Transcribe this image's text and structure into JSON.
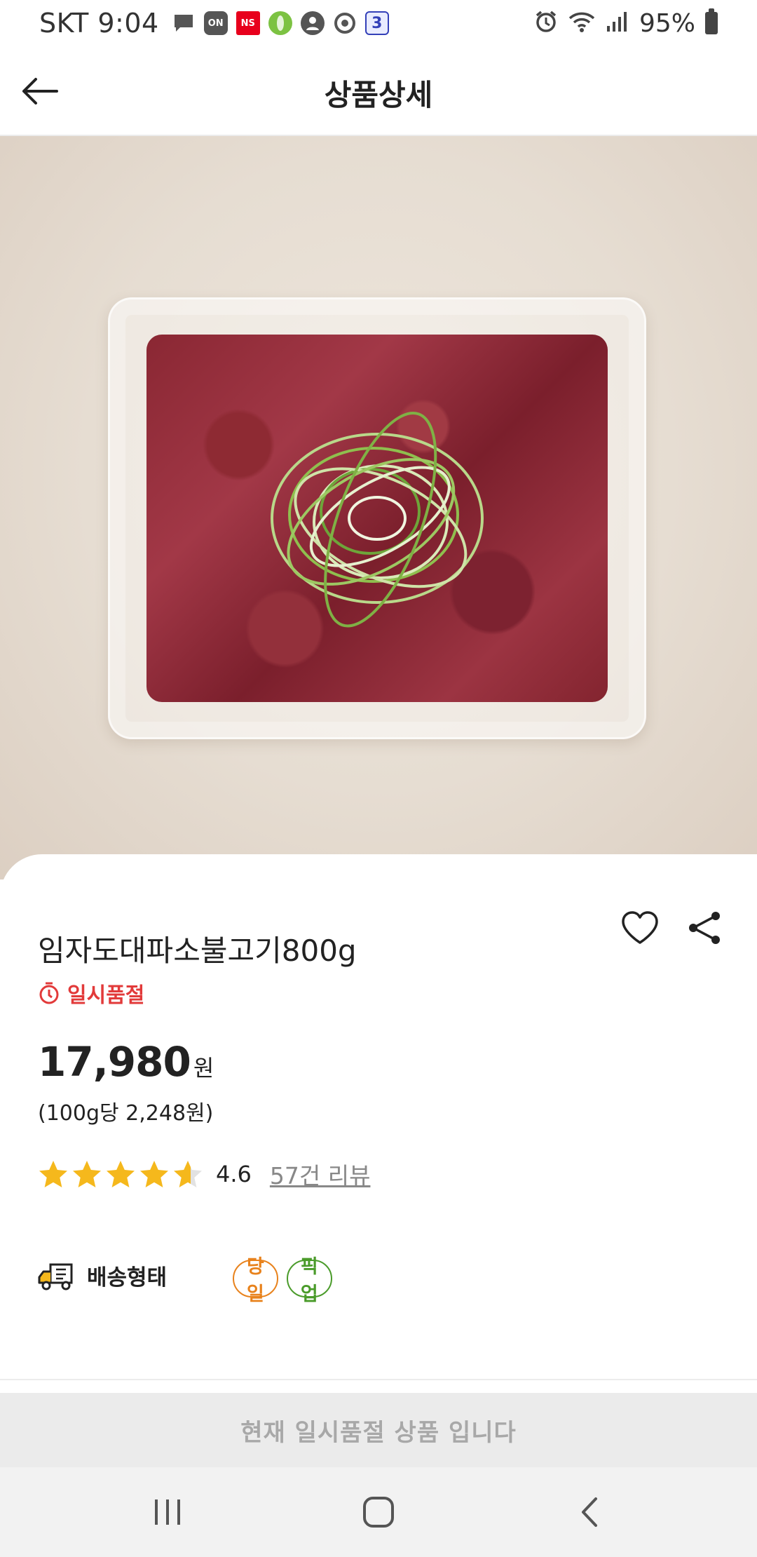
{
  "status_bar": {
    "carrier_time": "SKT 9:04",
    "notification_icons": [
      "message-icon",
      "on-app-icon",
      "ns-app-icon",
      "green-app-icon",
      "account-icon",
      "chrome-icon",
      "calendar-3-icon"
    ],
    "on_label": "ON",
    "ns_label": "NS",
    "calendar_label": "3",
    "battery_percent": "95%"
  },
  "header": {
    "title": "상품상세",
    "back_icon": "arrow-left-icon"
  },
  "product": {
    "name": "임자도대파소불고기800g",
    "stock_status": "일시품절",
    "price": "17,980",
    "currency": "원",
    "unit_price": "(100g당 2,248원)",
    "rating": "4.6",
    "rating_value": 4.6,
    "rating_max": 5,
    "review_link": "57건 리뷰",
    "delivery_label": "배송형태",
    "delivery_badges": [
      "당일",
      "픽업"
    ]
  },
  "footer": {
    "soldout_message": "현재 일시품절 상품 입니다"
  },
  "colors": {
    "accent_red": "#e23a3a",
    "star": "#f5b81c",
    "badge_orange": "#e8821c",
    "badge_green": "#4a9b2a"
  }
}
